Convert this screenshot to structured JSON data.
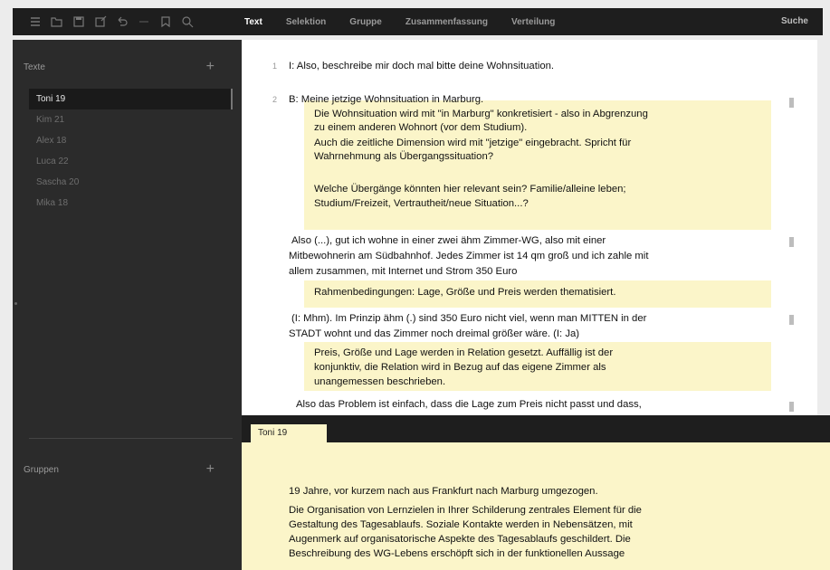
{
  "toolbar": {
    "icons": [
      "menu-icon",
      "folder-open-icon",
      "save-icon",
      "edit-icon",
      "undo-icon",
      "redo-icon",
      "bookmark-icon",
      "search-icon"
    ]
  },
  "tabs": [
    "Text",
    "Selektion",
    "Gruppe",
    "Zusammenfassung",
    "Verteilung"
  ],
  "search_label": "Suche",
  "sidebar": {
    "texts_header": "Texte",
    "items": [
      "Toni 19",
      "Kim 21",
      "Alex 18",
      "Luca 22",
      "Sascha 20",
      "Mika 18"
    ],
    "groups_header": "Gruppen"
  },
  "document": {
    "rows": [
      {
        "num": "1",
        "text": "I: Also, beschreibe mir doch mal bitte deine Wohnsituation."
      },
      {
        "num": "2",
        "text": "B: Meine jetzige Wohnsituation in Marburg."
      }
    ],
    "memo1": [
      "Die Wohnsituation wird mit \"in Marburg\" konkretisiert - also in Abgrenzung",
      "zu einem anderen Wohnort (vor dem Studium).",
      "Auch die zeitliche Dimension wird mit \"jetzige\" eingebracht. Spricht für",
      "Wahrnehmung als Übergangssituation?"
    ],
    "memo1b": [
      "Welche Übergänge könnten hier relevant sein? Familie/alleine leben;",
      "Studium/Freizeit, Vertrautheit/neue Situation...?"
    ],
    "para2": [
      "Also (...), gut ich wohne in einer zwei ähm Zimmer-WG, also mit einer",
      "Mitbewohnerin am Südbahnhof. Jedes Zimmer ist 14 qm groß und ich zahle mit",
      "allem zusammen, mit Internet und Strom 350 Euro"
    ],
    "memo2": "Rahmenbedingungen: Lage, Größe und Preis werden thematisiert.",
    "para3": [
      "(I: Mhm). Im Prinzip ähm (.) sind 350 Euro nicht viel, wenn man MITTEN in der",
      "STADT wohnt und das Zimmer noch dreimal größer wäre. (I: Ja)"
    ],
    "memo3": [
      "Preis, Größe und Lage werden in Relation gesetzt. Auffällig ist der",
      "konjunktiv, die Relation wird in Bezug auf das eigene Zimmer als",
      "unangemessen beschrieben."
    ],
    "para4": "Also das Problem ist einfach, dass die Lage zum Preis nicht passt und dass,"
  },
  "bottom": {
    "tab_label": "Toni 19",
    "lines": [
      "19 Jahre, vor kurzem nach aus Frankfurt nach Marburg umgezogen.",
      "Die Organisation von Lernzielen in Ihrer Schilderung zentrales Element für die",
      "Gestaltung des Tagesablaufs. Soziale Kontakte werden in Nebensätzen, mit",
      "Augenmerk auf organisatorische Aspekte des Tagesablaufs geschildert. Die",
      "Beschreibung des WG-Lebens erschöpft sich in der funktionellen Aussage"
    ]
  }
}
